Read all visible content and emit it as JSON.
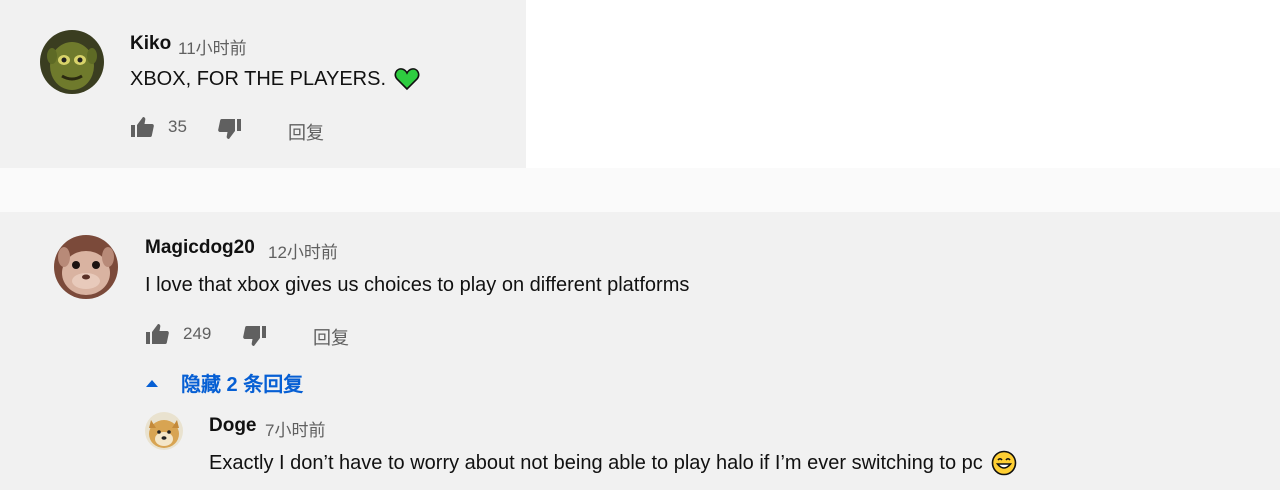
{
  "comments": [
    {
      "author": "Kiko",
      "time": "11小时前",
      "text": "XBOX, FOR THE PLAYERS.",
      "likes": "35",
      "reply_label": "回复"
    },
    {
      "author": "Magicdog20",
      "time": "12小时前",
      "text": "I love that xbox gives us choices to play on different platforms",
      "likes": "249",
      "reply_label": "回复",
      "replies_toggle": "隐藏 2 条回复",
      "replies": [
        {
          "author": "Doge",
          "time": "7小时前",
          "text": "Exactly I don’t have to worry about not being able to play halo if I’m ever switching to pc"
        }
      ]
    }
  ],
  "colors": {
    "panel": "#f1f1f1",
    "link_blue": "#065fd4",
    "meta_gray": "#606060",
    "heart_green": "#2ecc40"
  },
  "icons": [
    "green-heart-icon",
    "thumbs-up-icon",
    "thumbs-down-icon",
    "caret-up-icon",
    "grinning-emoji-icon"
  ]
}
